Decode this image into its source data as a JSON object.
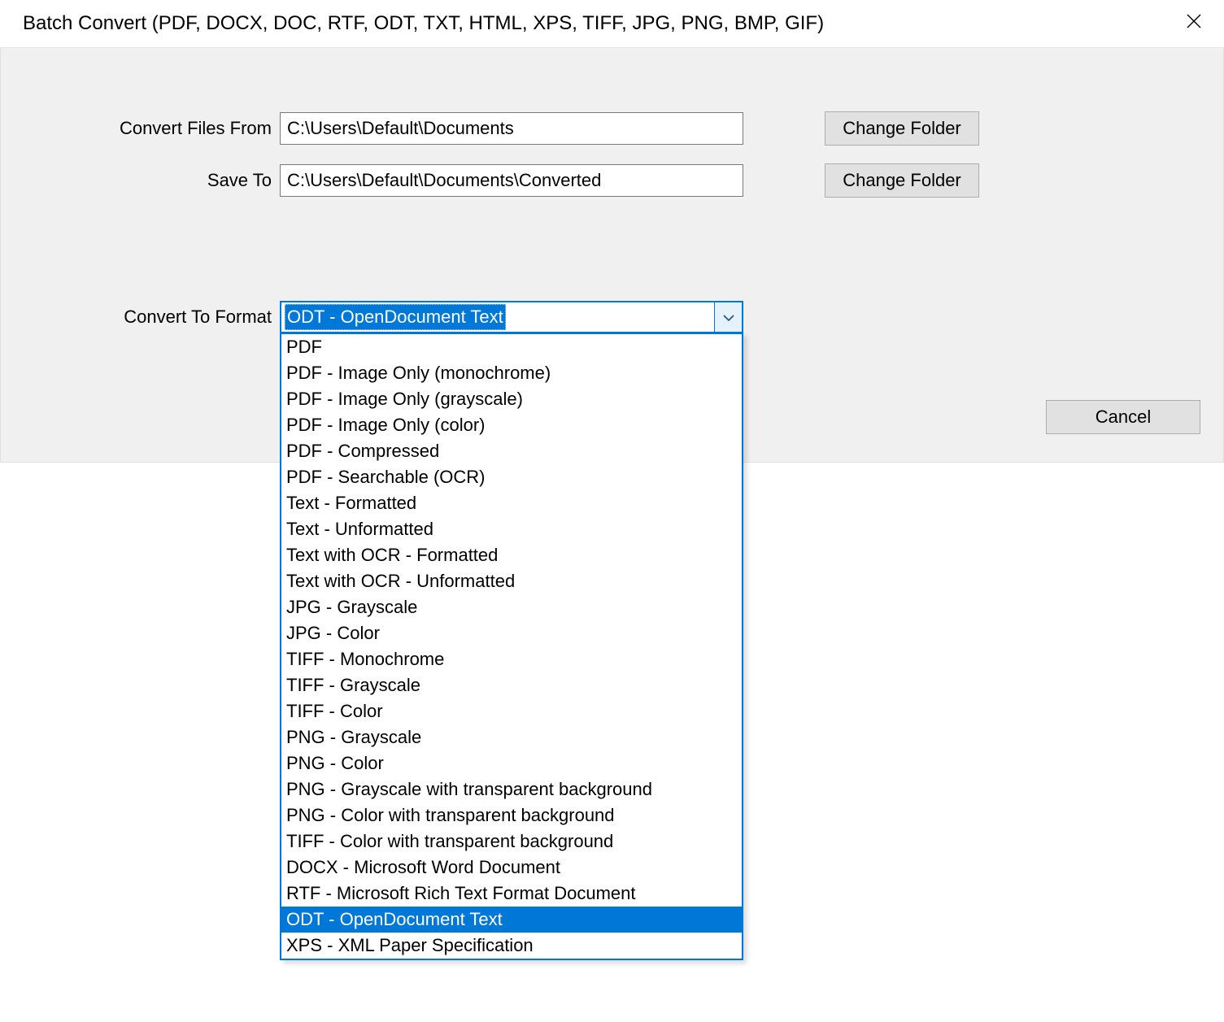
{
  "window": {
    "title": "Batch Convert (PDF, DOCX, DOC, RTF, ODT, TXT, HTML, XPS, TIFF, JPG, PNG, BMP, GIF)"
  },
  "labels": {
    "convert_from": "Convert Files From",
    "save_to": "Save To",
    "convert_format": "Convert To Format"
  },
  "paths": {
    "from": "C:\\Users\\Default\\Documents",
    "to": "C:\\Users\\Default\\Documents\\Converted"
  },
  "buttons": {
    "change_folder": "Change Folder",
    "cancel": "Cancel"
  },
  "format_select": {
    "selected": "ODT - OpenDocument Text",
    "options": [
      "PDF",
      "PDF - Image Only (monochrome)",
      "PDF - Image Only (grayscale)",
      "PDF - Image Only (color)",
      "PDF - Compressed",
      "PDF - Searchable (OCR)",
      "Text - Formatted",
      "Text - Unformatted",
      "Text with OCR - Formatted",
      "Text with OCR - Unformatted",
      "JPG - Grayscale",
      "JPG - Color",
      "TIFF - Monochrome",
      "TIFF - Grayscale",
      "TIFF - Color",
      "PNG - Grayscale",
      "PNG - Color",
      "PNG - Grayscale with transparent background",
      "PNG - Color with transparent background",
      "TIFF - Color with transparent background",
      "DOCX - Microsoft Word Document",
      "RTF - Microsoft Rich Text Format Document",
      "ODT - OpenDocument Text",
      "XPS - XML Paper Specification"
    ]
  }
}
